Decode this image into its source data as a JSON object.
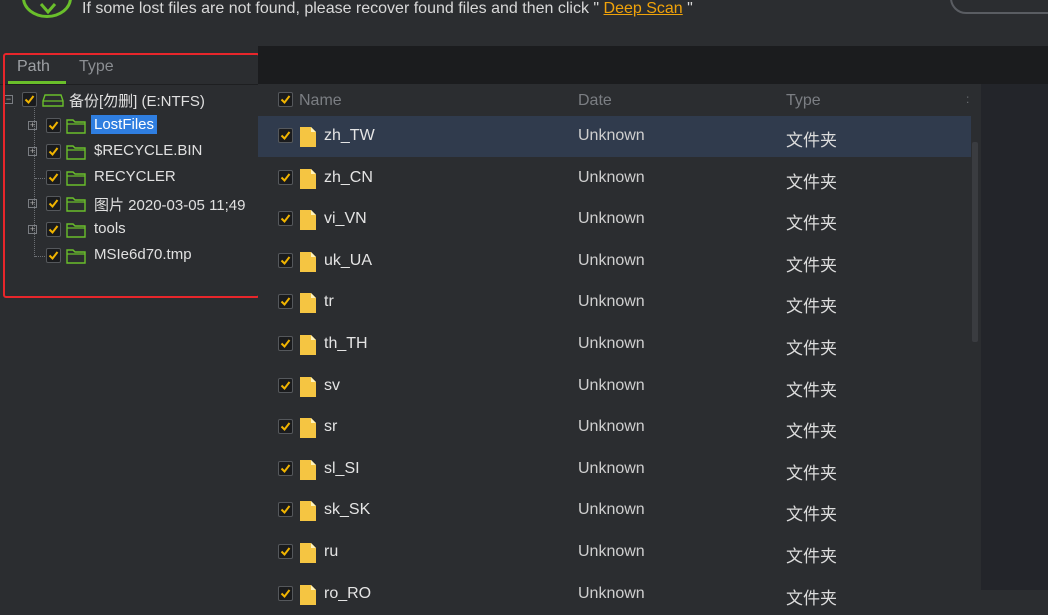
{
  "banner": {
    "message": "If some lost files are not found, please recover found files and then click \"",
    "link": "Deep Scan",
    "suffix": " \""
  },
  "tabs": [
    {
      "label": "Path",
      "active": true
    },
    {
      "label": "Type",
      "active": false
    }
  ],
  "tree": [
    {
      "label": "备份[勿删] (E:NTFS)",
      "icon": "drive-icon",
      "selected": false
    },
    {
      "label": "LostFiles",
      "icon": "folder-icon",
      "selected": true
    },
    {
      "label": "$RECYCLE.BIN",
      "icon": "folder-icon",
      "selected": false
    },
    {
      "label": "RECYCLER",
      "icon": "folder-icon",
      "selected": false
    },
    {
      "label": "图片 2020-03-05 11;49",
      "icon": "folder-icon",
      "selected": false
    },
    {
      "label": "tools",
      "icon": "folder-icon",
      "selected": false
    },
    {
      "label": "MSIe6d70.tmp",
      "icon": "folder-icon",
      "selected": false
    }
  ],
  "columns": {
    "name": "Name",
    "date": "Date",
    "type": "Type",
    "more": ":"
  },
  "rows": [
    {
      "name": "zh_TW",
      "date": "Unknown",
      "type": "文件夹"
    },
    {
      "name": "zh_CN",
      "date": "Unknown",
      "type": "文件夹"
    },
    {
      "name": "vi_VN",
      "date": "Unknown",
      "type": "文件夹"
    },
    {
      "name": "uk_UA",
      "date": "Unknown",
      "type": "文件夹"
    },
    {
      "name": "tr",
      "date": "Unknown",
      "type": "文件夹"
    },
    {
      "name": "th_TH",
      "date": "Unknown",
      "type": "文件夹"
    },
    {
      "name": "sv",
      "date": "Unknown",
      "type": "文件夹"
    },
    {
      "name": "sr",
      "date": "Unknown",
      "type": "文件夹"
    },
    {
      "name": "sl_SI",
      "date": "Unknown",
      "type": "文件夹"
    },
    {
      "name": "sk_SK",
      "date": "Unknown",
      "type": "文件夹"
    },
    {
      "name": "ru",
      "date": "Unknown",
      "type": "文件夹"
    },
    {
      "name": "ro_RO",
      "date": "Unknown",
      "type": "文件夹"
    }
  ],
  "colors": {
    "accent": "#6abf2b",
    "selection": "#2f7ee0",
    "highlight": "#e8262b",
    "folder": "#f5c542"
  }
}
